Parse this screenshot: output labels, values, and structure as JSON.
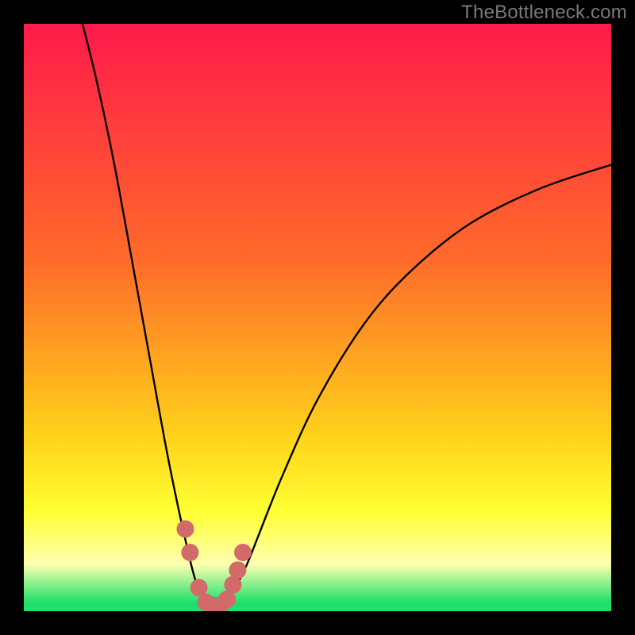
{
  "watermark": "TheBottleneck.com",
  "colors": {
    "page_bg": "#000000",
    "grad_top": "#ff1a4b",
    "grad_mid1": "#ff6a2a",
    "grad_mid2": "#ffd21a",
    "grad_low": "#ffff33",
    "grad_pale": "#ffffb0",
    "grad_green": "#1fe06a",
    "curve": "#000000",
    "marker": "#d26a6a"
  },
  "chart_data": {
    "type": "line",
    "title": "",
    "xlabel": "",
    "ylabel": "",
    "xlim": [
      0,
      100
    ],
    "ylim": [
      0,
      100
    ],
    "series": [
      {
        "name": "bottleneck-curve",
        "x": [
          10,
          12,
          14,
          16,
          18,
          20,
          22,
          24,
          26,
          28,
          29,
          30,
          31,
          32,
          33,
          34,
          35,
          36,
          38,
          40,
          44,
          50,
          58,
          66,
          76,
          88,
          100
        ],
        "y": [
          100,
          92,
          83,
          73,
          62,
          51,
          40,
          29,
          19,
          10,
          6,
          3,
          1.5,
          1,
          1,
          1.5,
          2.5,
          4,
          8,
          13,
          23,
          36,
          49,
          58,
          66,
          72,
          76
        ]
      }
    ],
    "markers": {
      "name": "highlight-dots",
      "x": [
        27.5,
        28.3,
        29.8,
        31.0,
        32.2,
        33.4,
        34.6,
        35.6,
        36.4,
        37.3
      ],
      "y": [
        14,
        10,
        4,
        1.5,
        1,
        1,
        2,
        4.5,
        7,
        10
      ]
    },
    "gradient_stops": [
      {
        "offset": 0.0,
        "key": "grad_top"
      },
      {
        "offset": 0.4,
        "key": "grad_mid1"
      },
      {
        "offset": 0.7,
        "key": "grad_mid2"
      },
      {
        "offset": 0.83,
        "key": "grad_low"
      },
      {
        "offset": 0.92,
        "key": "grad_pale"
      },
      {
        "offset": 0.985,
        "key": "grad_green"
      },
      {
        "offset": 1.0,
        "key": "grad_green"
      }
    ]
  }
}
